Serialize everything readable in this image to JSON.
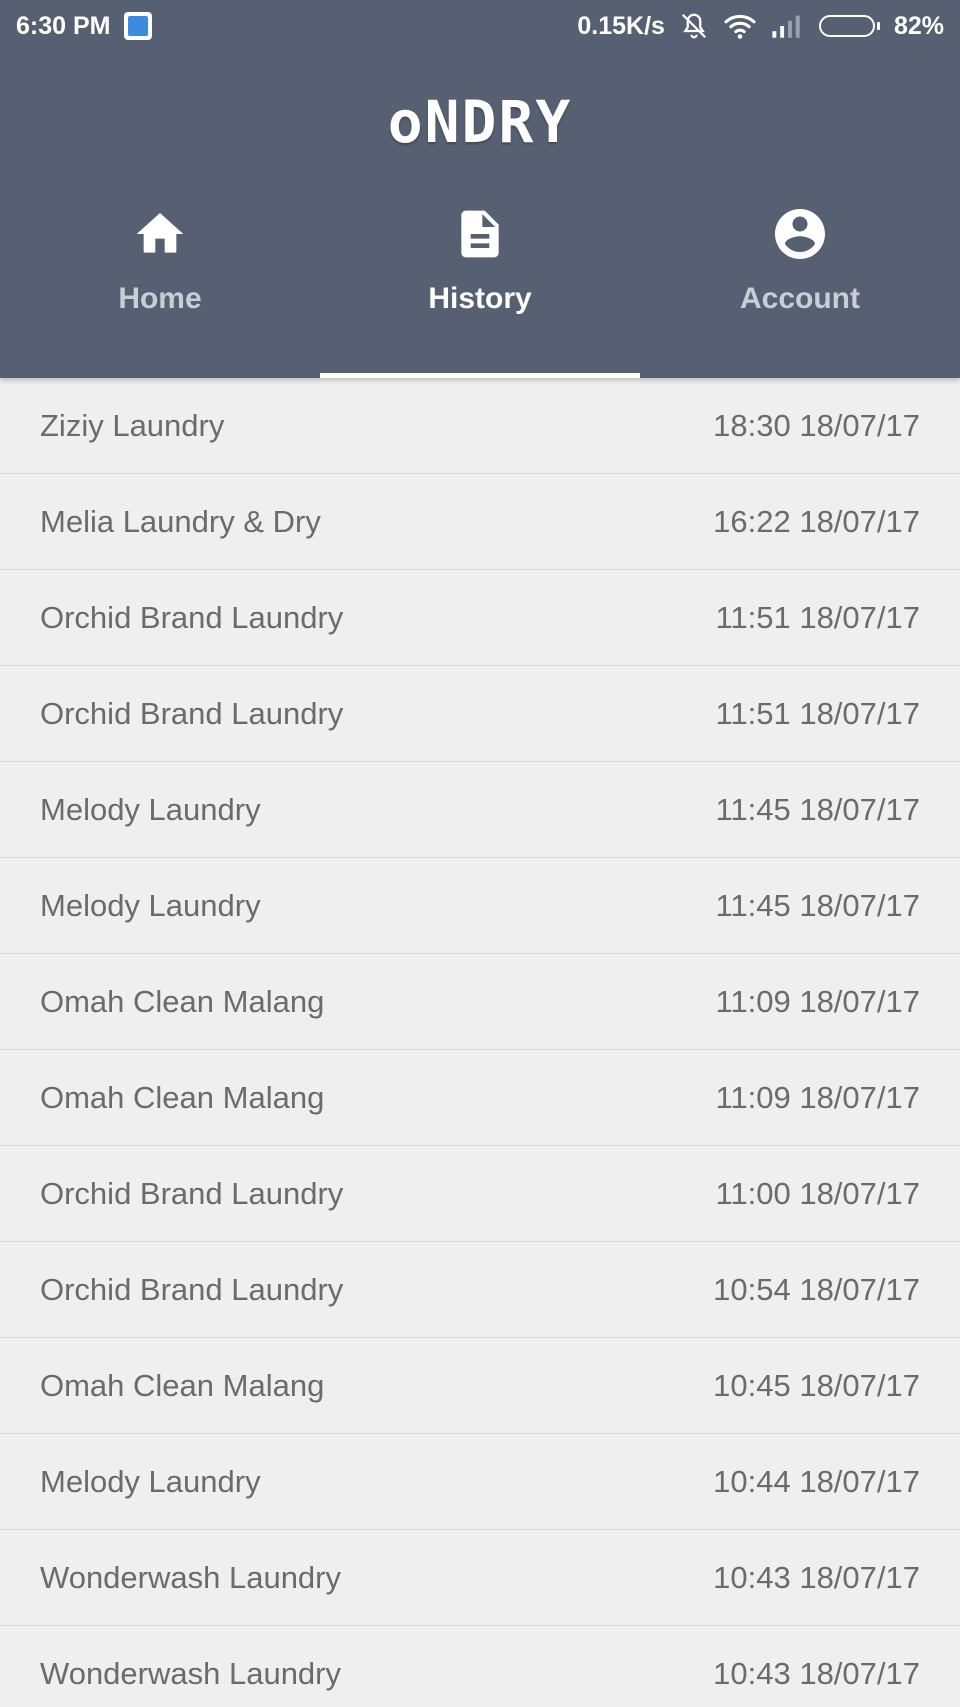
{
  "status_bar": {
    "time": "6:30 PM",
    "speed": "0.15K/s",
    "battery": "82%",
    "battery_level": 0.82
  },
  "app": {
    "logo": "oNDRY"
  },
  "tabs": [
    {
      "label": "Home",
      "icon": "home-icon",
      "active": false
    },
    {
      "label": "History",
      "icon": "document-icon",
      "active": true
    },
    {
      "label": "Account",
      "icon": "account-circle-icon",
      "active": false
    }
  ],
  "history": [
    {
      "name": "Ziziy Laundry",
      "time": "18:30 18/07/17"
    },
    {
      "name": "Melia Laundry & Dry",
      "time": "16:22 18/07/17"
    },
    {
      "name": "Orchid Brand Laundry",
      "time": "11:51 18/07/17"
    },
    {
      "name": "Orchid Brand Laundry",
      "time": "11:51 18/07/17"
    },
    {
      "name": "Melody Laundry",
      "time": "11:45 18/07/17"
    },
    {
      "name": "Melody Laundry",
      "time": "11:45 18/07/17"
    },
    {
      "name": "Omah Clean Malang",
      "time": "11:09 18/07/17"
    },
    {
      "name": "Omah Clean Malang",
      "time": "11:09 18/07/17"
    },
    {
      "name": "Orchid Brand Laundry",
      "time": "11:00 18/07/17"
    },
    {
      "name": "Orchid Brand Laundry",
      "time": "10:54 18/07/17"
    },
    {
      "name": "Omah Clean Malang",
      "time": "10:45 18/07/17"
    },
    {
      "name": "Melody Laundry",
      "time": "10:44 18/07/17"
    },
    {
      "name": "Wonderwash Laundry",
      "time": "10:43 18/07/17"
    },
    {
      "name": "Wonderwash Laundry",
      "time": "10:43 18/07/17"
    }
  ],
  "colors": {
    "header_bg": "#566072",
    "list_bg": "#efefef",
    "text": "#6b6b6b",
    "inactive_tab": "#c8cdd6",
    "active_tab": "#ffffff"
  }
}
